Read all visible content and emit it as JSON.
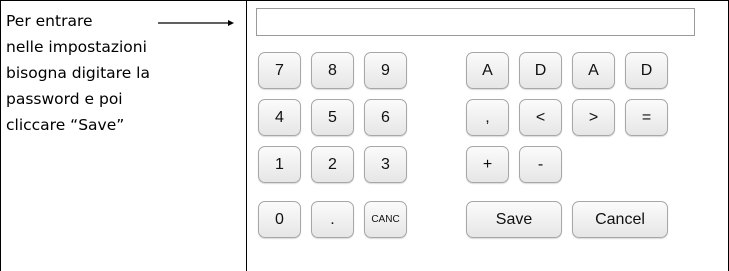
{
  "instructions": {
    "lines": [
      "Per entrare",
      "nelle impostazioni",
      "bisogna digitare la",
      "password e poi",
      "cliccare “Save”"
    ]
  },
  "display": {
    "value": ""
  },
  "keypad": {
    "digits": [
      "7",
      "8",
      "9",
      "4",
      "5",
      "6",
      "1",
      "2",
      "3",
      "0",
      ".",
      "CANC"
    ],
    "symbols": [
      "A",
      "D",
      "A",
      "D",
      ",",
      "<",
      ">",
      "=",
      "+",
      "-"
    ],
    "save_label": "Save",
    "cancel_label": "Cancel"
  },
  "icons": {
    "arrow": "arrow-right-icon"
  }
}
